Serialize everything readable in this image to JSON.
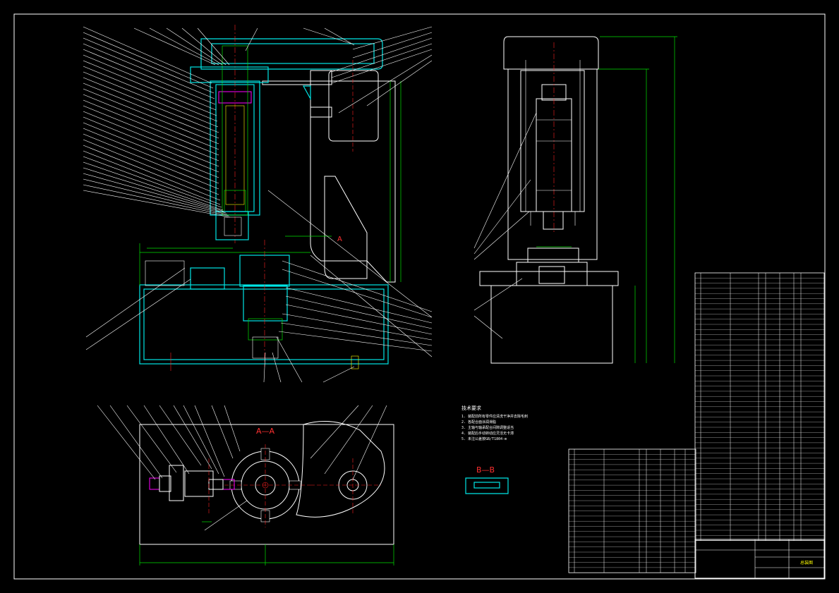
{
  "views": {
    "section_aa": "A—A",
    "section_bb": "B—B",
    "marker_a": "A"
  },
  "notes": {
    "lines": [
      "技术要求",
      "1. 装配前所有零件应清洗干净并去除毛刺",
      "2. 各配合面涂润滑脂",
      "3. 主轴与轴承配合间隙调整适当",
      "4. 装配后手动转动应灵活无卡滞",
      "5. 未注公差按GB/T1804-m"
    ]
  },
  "title_block": {
    "drawing_title": "总装图"
  }
}
